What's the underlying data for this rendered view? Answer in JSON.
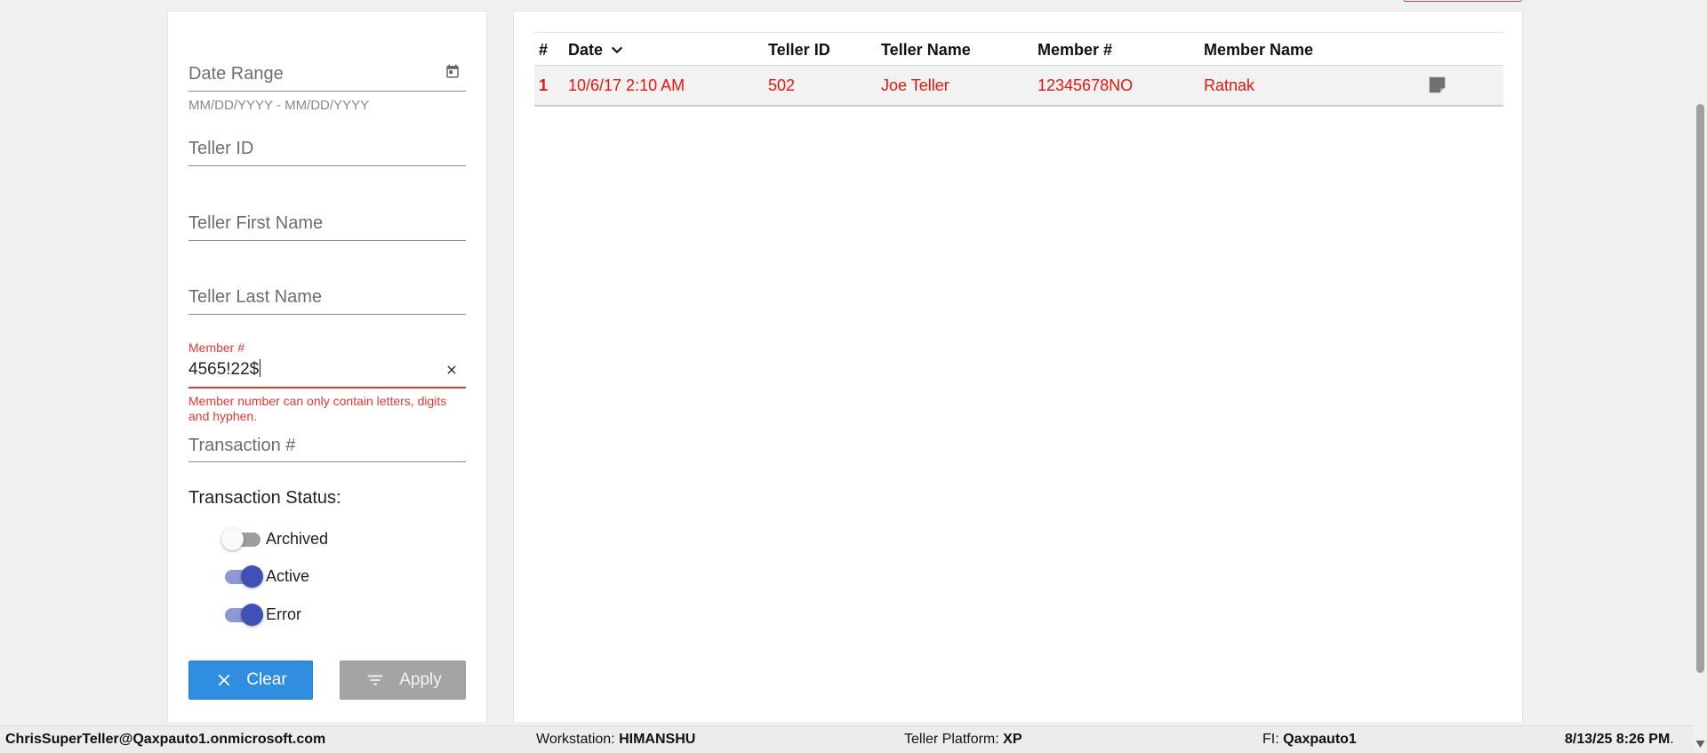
{
  "filters": {
    "date_range": {
      "placeholder": "Date Range",
      "hint": "MM/DD/YYYY - MM/DD/YYYY"
    },
    "teller_id": {
      "placeholder": "Teller ID"
    },
    "teller_first_name": {
      "placeholder": "Teller First Name"
    },
    "teller_last_name": {
      "placeholder": "Teller Last Name"
    },
    "member_number": {
      "label": "Member #",
      "value": "4565!22$",
      "error": "Member number can only contain letters, digits and hyphen."
    },
    "transaction_number": {
      "placeholder": "Transaction #"
    },
    "transaction_status": {
      "title": "Transaction Status:",
      "toggles": [
        {
          "label": "Archived",
          "on": false
        },
        {
          "label": "Active",
          "on": true
        },
        {
          "label": "Error",
          "on": true
        }
      ]
    },
    "clear_label": "Clear",
    "apply_label": "Apply"
  },
  "table": {
    "columns": [
      "#",
      "Date",
      "Teller ID",
      "Teller Name",
      "Member #",
      "Member Name"
    ],
    "rows": [
      {
        "num": "1",
        "date": "10/6/17 2:10 AM",
        "teller_id": "502",
        "teller_name": "Joe Teller",
        "member_number": "12345678NO",
        "member_name": "Ratnak"
      }
    ]
  },
  "status_bar": {
    "user": "ChrisSuperTeller@Qaxpauto1.onmicrosoft.com",
    "workstation_label": "Workstation:",
    "workstation": "HIMANSHU",
    "platform_label": "Teller Platform:",
    "platform": "XP",
    "fi_label": "FI:",
    "fi": "Qaxpauto1",
    "datetime": "8/13/25 8:26 PM",
    "datetime_suffix": "."
  },
  "colors": {
    "error_red": "#e53935",
    "row_text_red": "#e8160c",
    "toggle_on": "#3f51b5",
    "clear_button": "#2f8ee0",
    "apply_button": "#a4a4a4"
  }
}
